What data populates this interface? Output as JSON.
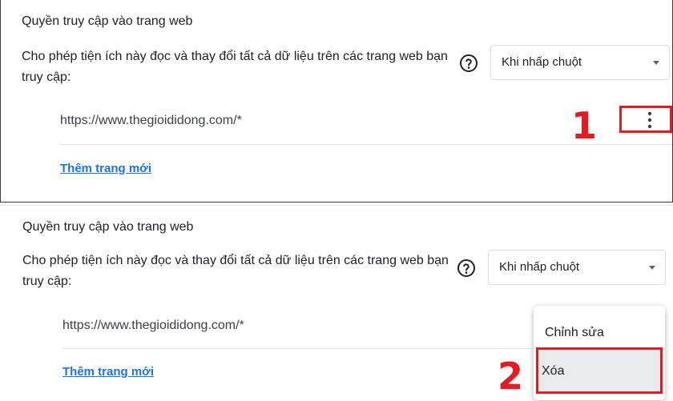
{
  "site_access_top": {
    "title": "Quyền truy cập vào trang web",
    "description": "Cho phép tiện ích này đọc và thay đổi tất cả dữ liệu trên các trang web bạn truy cập:",
    "select_value": "Khi nhấp chuột",
    "site_url": "https://www.thegioididong.com/*",
    "add_site_label": "Thêm trang mới",
    "step_label": "1"
  },
  "site_access_bottom": {
    "title": "Quyền truy cập vào trang web",
    "description": "Cho phép tiện ích này đọc và thay đổi tất cả dữ liệu trên các trang web bạn truy cập:",
    "select_value": "Khi nhấp chuột",
    "site_url": "https://www.thegioididong.com/*",
    "add_site_label": "Thêm trang mới",
    "step_label": "2"
  },
  "context_menu": {
    "items": [
      "Chỉnh sửa",
      "Xóa"
    ]
  },
  "colors": {
    "annotation_red": "#e31b23",
    "link_blue": "#1a73e8"
  },
  "icons": [
    "help-icon",
    "more-vert-icon",
    "chevron-down-icon"
  ]
}
